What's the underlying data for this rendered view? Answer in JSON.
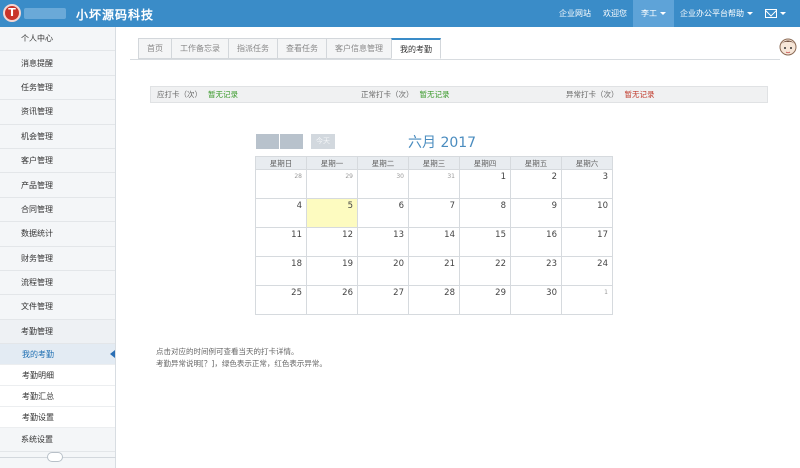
{
  "app": {
    "logo_letter": "T",
    "brand": "小坏源码科技"
  },
  "topnav": {
    "portal": "企业网站",
    "welcome": "欢迎您",
    "user": "李工",
    "help": "企业办公平台帮助"
  },
  "sidebar": {
    "items": [
      "个人中心",
      "消息提醒",
      "任务管理",
      "资讯管理",
      "机会管理",
      "客户管理",
      "产品管理",
      "合同管理",
      "数据统计",
      "财务管理",
      "流程管理",
      "文件管理",
      "考勤管理"
    ],
    "subitems": [
      "我的考勤",
      "考勤明细",
      "考勤汇总",
      "考勤设置"
    ],
    "last": "系统设置"
  },
  "tabs": [
    "首页",
    "工作备忘录",
    "指派任务",
    "查看任务",
    "客户信息管理",
    "我的考勤"
  ],
  "stats": [
    {
      "label": "应打卡（次）",
      "value": "暂无记录"
    },
    {
      "label": "正常打卡（次）",
      "value": "暂无记录"
    },
    {
      "label": "异常打卡（次）",
      "value": "暂无记录"
    }
  ],
  "colors": {
    "ok": "#3a9a2a",
    "bad": "#c0392b",
    "accent": "#3a8cc8"
  },
  "calendar": {
    "today_label": "今天",
    "title": "六月 2017",
    "weekdays": [
      "星期日",
      "星期一",
      "星期二",
      "星期三",
      "星期四",
      "星期五",
      "星期六"
    ],
    "weeks": [
      [
        "28",
        "29",
        "30",
        "31",
        "1",
        "2",
        "3"
      ],
      [
        "4",
        "5",
        "6",
        "7",
        "8",
        "9",
        "10"
      ],
      [
        "11",
        "12",
        "13",
        "14",
        "15",
        "16",
        "17"
      ],
      [
        "18",
        "19",
        "20",
        "21",
        "22",
        "23",
        "24"
      ],
      [
        "25",
        "26",
        "27",
        "28",
        "29",
        "30",
        "1"
      ]
    ]
  },
  "notes": [
    "点击对应的时间例可查看当天的打卡详情。",
    "考勤异常说明[？]，绿色表示正常，红色表示异常。"
  ]
}
